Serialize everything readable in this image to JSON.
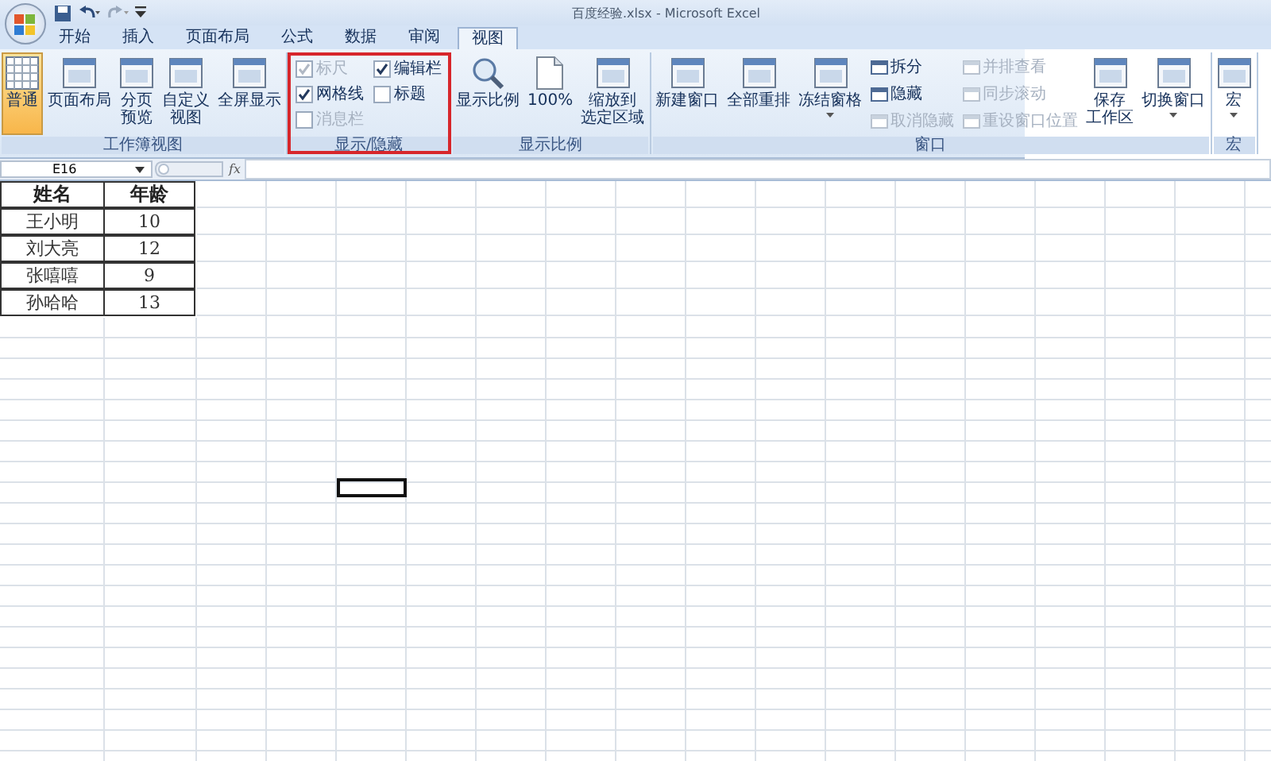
{
  "window": {
    "title": "百度经验.xlsx - Microsoft Excel"
  },
  "tabs": [
    {
      "label": "开始",
      "selected": false
    },
    {
      "label": "插入",
      "selected": false
    },
    {
      "label": "页面布局",
      "selected": false
    },
    {
      "label": "公式",
      "selected": false
    },
    {
      "label": "数据",
      "selected": false
    },
    {
      "label": "审阅",
      "selected": false
    },
    {
      "label": "视图",
      "selected": true
    }
  ],
  "ribbon": {
    "groups": [
      {
        "label": "工作簿视图",
        "highlighted": false,
        "items": [
          {
            "kind": "large",
            "lines": [
              "普通"
            ],
            "selected": true
          },
          {
            "kind": "large",
            "lines": [
              "页面布局"
            ],
            "selected": false
          },
          {
            "kind": "large",
            "lines": [
              "分页",
              "预览"
            ],
            "selected": false
          },
          {
            "kind": "large",
            "lines": [
              "自定义",
              "视图"
            ],
            "selected": false
          },
          {
            "kind": "large",
            "lines": [
              "全屏显示"
            ],
            "selected": false
          }
        ]
      },
      {
        "label": "显示/隐藏",
        "highlighted": true,
        "items": [
          {
            "kind": "checks",
            "checks": [
              {
                "label": "标尺",
                "checked": true,
                "disabled": true
              },
              {
                "label": "编辑栏",
                "checked": true,
                "disabled": false
              },
              {
                "label": "网格线",
                "checked": true,
                "disabled": false
              },
              {
                "label": "标题",
                "checked": false,
                "disabled": false
              },
              {
                "label": "消息栏",
                "checked": false,
                "disabled": true
              }
            ]
          }
        ]
      },
      {
        "label": "显示比例",
        "highlighted": false,
        "items": [
          {
            "kind": "large",
            "lines": [
              "显示比例"
            ],
            "selected": false
          },
          {
            "kind": "large",
            "lines": [
              "100%"
            ],
            "selected": false
          },
          {
            "kind": "large",
            "lines": [
              "缩放到",
              "选定区域"
            ],
            "selected": false
          }
        ]
      },
      {
        "label": "窗口",
        "highlighted": false,
        "items": [
          {
            "kind": "large",
            "lines": [
              "新建窗口"
            ],
            "selected": false
          },
          {
            "kind": "large",
            "lines": [
              "全部重排"
            ],
            "selected": false
          },
          {
            "kind": "large",
            "lines": [
              "冻结窗格"
            ],
            "selected": false,
            "dropdown": true
          },
          {
            "kind": "smalls",
            "smalls": [
              {
                "label": "拆分",
                "disabled": false
              },
              {
                "label": "隐藏",
                "disabled": false
              },
              {
                "label": "取消隐藏",
                "disabled": true
              }
            ]
          },
          {
            "kind": "smalls",
            "smalls": [
              {
                "label": "并排查看",
                "disabled": true
              },
              {
                "label": "同步滚动",
                "disabled": true
              },
              {
                "label": "重设窗口位置",
                "disabled": true
              }
            ]
          },
          {
            "kind": "large",
            "lines": [
              "保存",
              "工作区"
            ],
            "selected": false
          },
          {
            "kind": "large",
            "lines": [
              "切换窗口"
            ],
            "selected": false,
            "dropdown": true
          }
        ]
      },
      {
        "label": "宏",
        "highlighted": false,
        "items": [
          {
            "kind": "large",
            "lines": [
              "宏"
            ],
            "selected": false,
            "dropdown": true
          }
        ]
      }
    ]
  },
  "formula_bar": {
    "name_box": "E16",
    "function_label": "fx"
  },
  "sheet": {
    "columns": [
      "姓名",
      "年龄"
    ],
    "rows": [
      [
        "王小明",
        "10"
      ],
      [
        "刘大亮",
        "12"
      ],
      [
        "张嘻嘻",
        "9"
      ],
      [
        "孙哈哈",
        "13"
      ]
    ]
  }
}
